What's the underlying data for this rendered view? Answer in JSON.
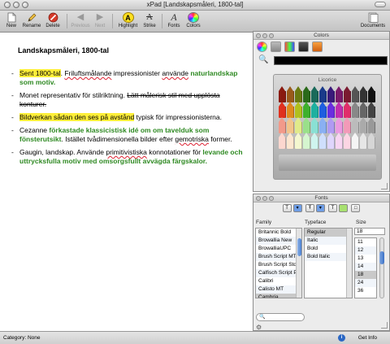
{
  "window": {
    "title": "xPad [Landskapsmåleri, 1800-tal]"
  },
  "toolbar": {
    "new": "New",
    "rename": "Rename",
    "delete": "Delete",
    "previous": "Previous",
    "next": "Next",
    "highlight": "Highlight",
    "strike": "Strike",
    "fonts": "Fonts",
    "colors": "Colors",
    "documents": "Documents",
    "highlight_glyph": "A",
    "strike_glyph": "A",
    "fonts_glyph": "A"
  },
  "document": {
    "title": "Landskapsmåleri, 1800-tal",
    "bullet_dash": "-",
    "b1": {
      "hl": "Sent 1800-tal",
      "p1": ". ",
      "sq1": "Friluftsmålande",
      "p2": " impressionister ",
      "sq2": "använde",
      "p3": " ",
      "green": "naturlandskap som motiv."
    },
    "b2": {
      "p1": "Monet representativ för stilriktning. ",
      "strike": "Lätt målerisk stil med upplösta konturer."
    },
    "b3": {
      "hl": "Bildverkan sådan den ses på avstånd",
      "p1": " typisk för impressionisterna."
    },
    "b4": {
      "p1": "Cezanne ",
      "green": "förkastade klassicistisk idé om om tavelduk som fönsterutsikt",
      "p2": ". Istället tvådimensionella bilder efter ",
      "sq": "gemotriska",
      "p3": " former."
    },
    "b5": {
      "p1": "Gaugin, landskap. Använde ",
      "sq": "primitivistiska",
      "p2": " konnotationer för ",
      "green": "levande och uttrycksfulla motiv med omsorgsfullt avvägda färgskalor."
    }
  },
  "colors_panel": {
    "title": "Colors",
    "palette_name": "Licorice",
    "current_color": "#000000",
    "crayon_rows": [
      [
        "#8a1a10",
        "#9a5a1a",
        "#6a7a10",
        "#2a6a1a",
        "#1a6a5a",
        "#1a3a8a",
        "#3a1a7a",
        "#7a1a6a",
        "#7a1a30",
        "#555555",
        "#333333",
        "#111111"
      ],
      [
        "#e0301e",
        "#e08a1e",
        "#b0c01e",
        "#3eb02e",
        "#1eb0a0",
        "#1e5ee0",
        "#6a2ee0",
        "#c02eb0",
        "#e02e6a",
        "#888888",
        "#666666",
        "#444444"
      ],
      [
        "#f29a8a",
        "#f2c48a",
        "#e0ea8a",
        "#9ae08a",
        "#8ae0d4",
        "#8ab0f2",
        "#b09af2",
        "#ea9ae0",
        "#f29ab8",
        "#bbbbbb",
        "#aaaaaa",
        "#999999"
      ],
      [
        "#fcd7cf",
        "#fce6cf",
        "#f4f7cf",
        "#d5f5cf",
        "#cff4ef",
        "#cfdffc",
        "#dfd5fc",
        "#f7d5f2",
        "#fcd5e3",
        "#f5f5f5",
        "#e6e6e6",
        "#d6d6d6"
      ]
    ]
  },
  "fonts_panel": {
    "title": "Fonts",
    "family_label": "Family",
    "typeface_label": "Typeface",
    "size_label": "Size",
    "families": [
      "Britannic Bold",
      "Browallia New",
      "BrowalliaUPC",
      "Brush Script MT",
      "Brush Script Std",
      "Calfisch Script Pro",
      "Calibri",
      "Calisto MT",
      "Cambria"
    ],
    "selected_family": "Cambria",
    "typefaces": [
      "Regular",
      "Italic",
      "Bold",
      "Bold Italic"
    ],
    "selected_typeface": "Regular",
    "size_value": "18",
    "sizes": [
      "11",
      "12",
      "13",
      "14",
      "18",
      "24",
      "36"
    ],
    "selected_size": "18",
    "search_icon": "🔍",
    "gear_icon": "⚙"
  },
  "status": {
    "category": "Category: None",
    "get_info": "Get Info",
    "info_icon": "i"
  }
}
